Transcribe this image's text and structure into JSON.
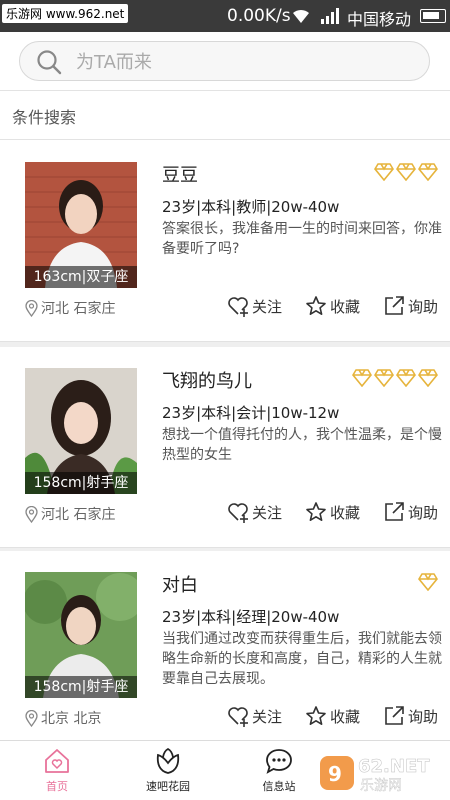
{
  "statusbar": {
    "watermark": "乐游网 www.962.net",
    "speed": "0.00K/s",
    "carrier": "中国移动"
  },
  "search": {
    "placeholder": "为TA而来",
    "value": ""
  },
  "filter": {
    "label": "条件搜索"
  },
  "actions": {
    "follow": "关注",
    "favorite": "收藏",
    "inquire": "询助"
  },
  "profiles": [
    {
      "name": "豆豆",
      "stats": "23岁|本科|教师|20w-40w",
      "bio": "答案很长，我准备用一生的时间来回答，你准备要听了吗?",
      "caption": "163cm|双子座",
      "location": "河北 石家庄",
      "diamonds": 3
    },
    {
      "name": "飞翔的鸟儿",
      "stats": "23岁|本科|会计|10w-12w",
      "bio": "想找一个值得托付的人，我个性温柔，是个慢热型的女生",
      "caption": "158cm|射手座",
      "location": "河北 石家庄",
      "diamonds": 4
    },
    {
      "name": "对白",
      "stats": "23岁|本科|经理|20w-40w",
      "bio": "当我们通过改变而获得重生后，我们就能去领略生命新的长度和高度，自己，精彩的人生就要靠自己去展现。",
      "caption": "158cm|射手座",
      "location": "北京 北京",
      "diamonds": 1
    }
  ],
  "tabs": [
    {
      "label": "首页",
      "icon": "home-heart-icon"
    },
    {
      "label": "速吧花园",
      "icon": "flower-icon"
    },
    {
      "label": "信息站",
      "icon": "chat-bubble-icon"
    }
  ],
  "watermark_text": "962.NET 乐游网",
  "colors": {
    "accent_pink": "#e8729a",
    "diamond_gold": "#e6b43c",
    "statusbar": "#3a3a3a"
  }
}
